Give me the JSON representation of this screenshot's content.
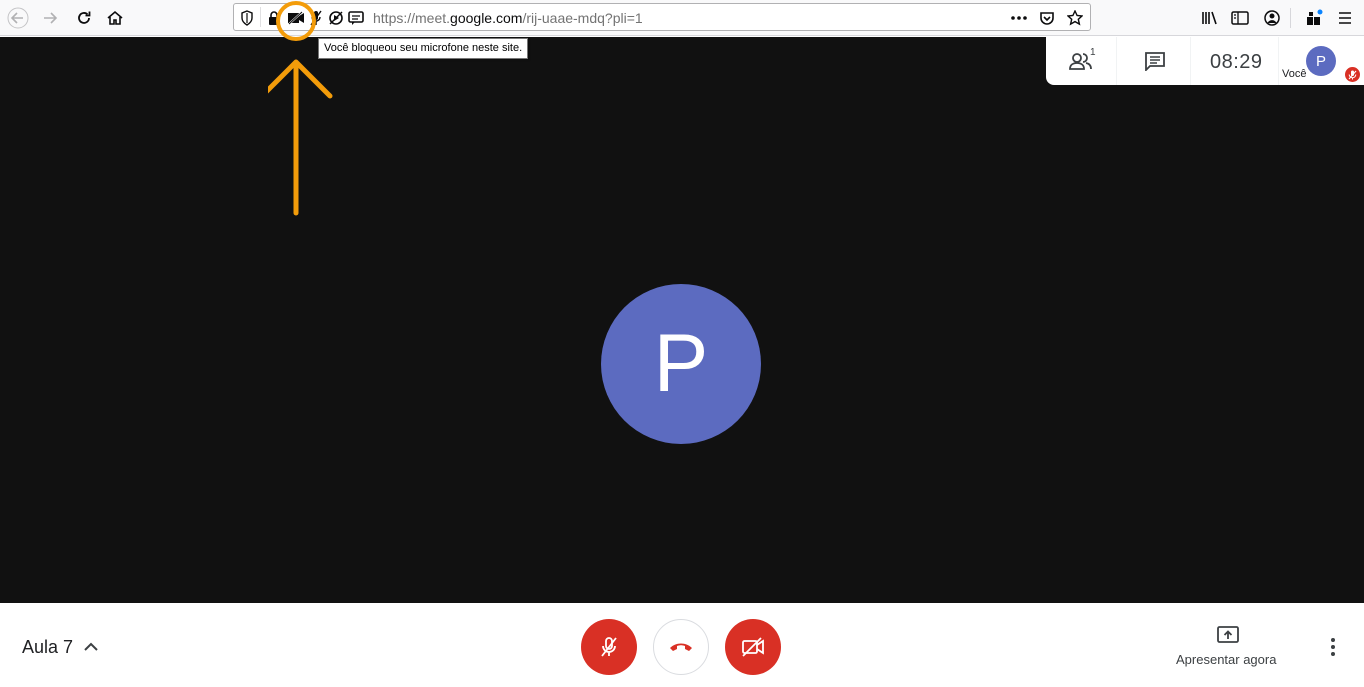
{
  "browser": {
    "url_prefix": "https://meet.",
    "url_host": "google.com",
    "url_path": "/rij-uaae-mdq?pli=1",
    "tooltip": "Você bloqueou seu microfone neste site."
  },
  "meet": {
    "participant_initial": "P",
    "participant_count": "1",
    "clock": "08:29",
    "self_initial": "P",
    "self_label": "Você",
    "meeting_name": "Aula 7",
    "present_label": "Apresentar agora"
  },
  "colors": {
    "stage_bg": "#111111",
    "avatar": "#5c6bc0",
    "red_button": "#d93025",
    "annotation_orange": "#f39c0a"
  }
}
